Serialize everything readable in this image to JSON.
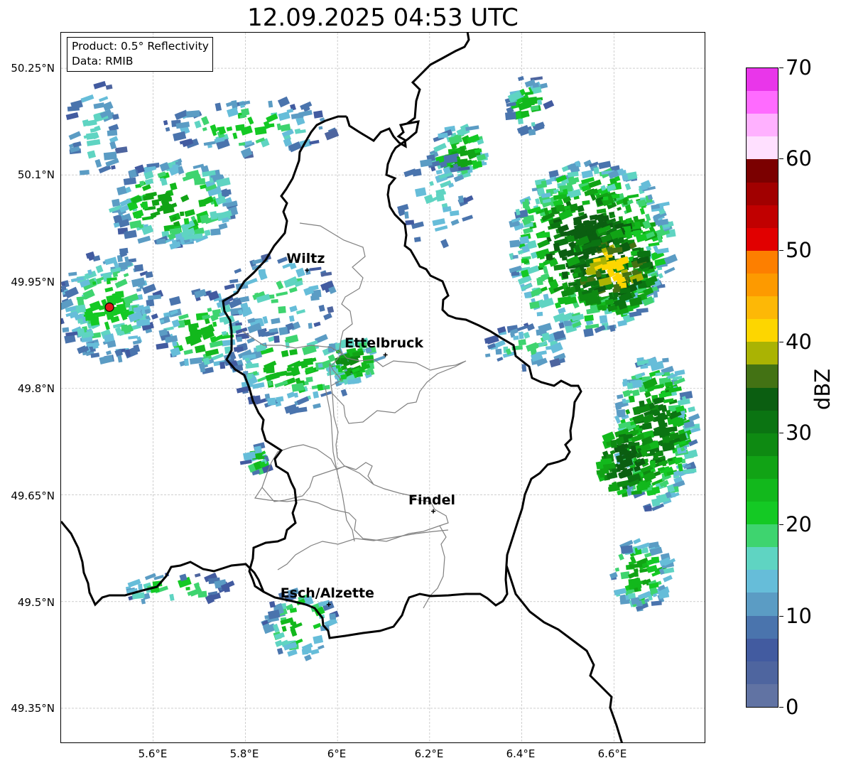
{
  "title": "12.09.2025 04:53 UTC",
  "info_box": {
    "line1": "Product: 0.5° Reflectivity",
    "line2": "Data: RMIB"
  },
  "latitude_labels": [
    "50.25°N",
    "50.1°N",
    "49.95°N",
    "49.8°N",
    "49.65°N",
    "49.5°N",
    "49.35°N"
  ],
  "longitude_labels": [
    "5.6°E",
    "5.8°E",
    "6°E",
    "6.2°E",
    "6.4°E",
    "6.6°E"
  ],
  "cities": [
    {
      "name": "Wiltz",
      "lon": 5.934,
      "lat": 49.966
    },
    {
      "name": "Ettelbruck",
      "lon": 6.104,
      "lat": 49.847
    },
    {
      "name": "Findel",
      "lon": 6.208,
      "lat": 49.627
    },
    {
      "name": "Esch/Alzette",
      "lon": 5.981,
      "lat": 49.496
    }
  ],
  "radar_site": {
    "lon": 5.505,
    "lat": 49.914,
    "color": "#e0191b"
  },
  "map_extent": {
    "lon": [
      5.4,
      6.8
    ],
    "lat": [
      49.3,
      50.3
    ]
  },
  "colorbar": {
    "unit": "dBZ",
    "tick_labels": [
      "0",
      "10",
      "20",
      "30",
      "40",
      "50",
      "60",
      "70"
    ],
    "range": [
      0,
      70
    ],
    "step": 2.5,
    "colors": [
      "#6173a3",
      "#4e659f",
      "#425ba0",
      "#4a74ad",
      "#5b9cc4",
      "#66bdd9",
      "#5fd4c2",
      "#3ed46f",
      "#14c924",
      "#12b81c",
      "#11a315",
      "#0e8a12",
      "#0b7412",
      "#0b5e11",
      "#437214",
      "#aab303",
      "#fdd600",
      "#fdb806",
      "#fd9a00",
      "#fd7f00",
      "#e10000",
      "#c10000",
      "#a10000",
      "#7b0000",
      "#ffe0ff",
      "#ffb1ff",
      "#ff6bff",
      "#e936ea"
    ]
  }
}
